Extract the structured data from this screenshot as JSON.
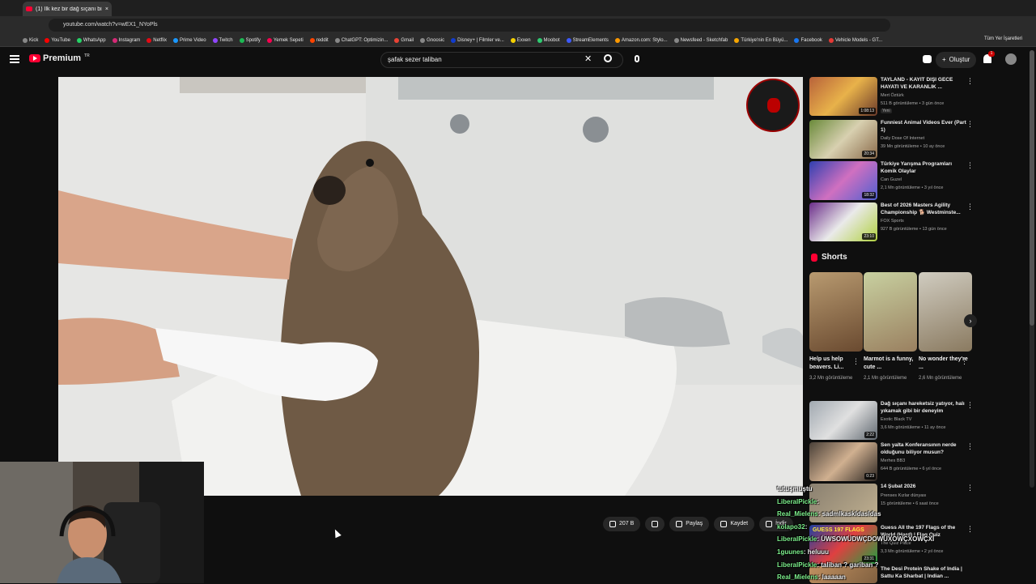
{
  "browser": {
    "tab_title": "(1) İlk kez bir dağ sıçanı bir...",
    "url": "youtube.com/watch?v=wEX1_NYoPls",
    "bookmarks": [
      "Kick",
      "YouTube",
      "WhatsApp",
      "Instagram",
      "Netflix",
      "Prime Video",
      "Twitch",
      "Spotify",
      "Yemek Sepeti",
      "reddit",
      "ChatGPT: Optimizin...",
      "Gmail",
      "Gnoosic",
      "Disney+ | Filmler ve...",
      "Exxen",
      "Moobot",
      "StreamElements",
      "Amazon.com: Stylo...",
      "Newsfeed - Sketchfab",
      "Türkiye'nin En Büyü...",
      "Facebook",
      "Vehicle Models - GT..."
    ],
    "bookmarks_all": "Tüm Yer İşaretleri"
  },
  "header": {
    "logo_text": "Premium",
    "logo_sup": "TR",
    "search_value": "şafak sezer taliban",
    "search_clear": "✕",
    "create_label": "Oluştur",
    "create_plus": "+",
    "notif_count": "1"
  },
  "actions": {
    "like_count": "207 B",
    "share_label": "Paylaş",
    "save_label": "Kaydet",
    "download_label": "İndir"
  },
  "recommendations": [
    {
      "title": "TAYLAND - KAYIT DIŞI GECE HAYATI VE KARANLIK ...",
      "channel": "Mert Öztürk",
      "meta": "511 B görüntüleme • 3 gün önce",
      "badge": "Yeni",
      "duration": "1:08:13"
    },
    {
      "title": "Funniest Animal Videos Ever (Part 1)",
      "channel": "Daily Dose Of Internet",
      "meta": "39 Mn görüntüleme • 10 ay önce",
      "badge": "",
      "duration": "20:34"
    },
    {
      "title": "Türkiye Yarışma Programları Komik Olaylar",
      "channel": "Can Guzel",
      "meta": "2,1 Mn görüntüleme • 3 yıl önce",
      "badge": "",
      "duration": "18:32"
    },
    {
      "title": "Best of 2026 Masters Agility Championship 🐕 Westminste...",
      "channel": "FOX Sports",
      "meta": "927 B görüntüleme • 13 gün önce",
      "badge": "",
      "duration": "23:10"
    }
  ],
  "shorts": {
    "header": "Shorts",
    "next": "›",
    "items": [
      {
        "title": "Help us help beavers. Li...",
        "views": "3,2 Mn görüntüleme"
      },
      {
        "title": "Marmot is a funny, cute ...",
        "views": "2,1 Mn görüntüleme"
      },
      {
        "title": "No wonder they're ...",
        "views": "2,6 Mn görüntüleme"
      }
    ]
  },
  "recommendations2": [
    {
      "title": "Dağ sıçanı hareketsiz yatıyor, halı yıkamak gibi bir deneyim",
      "channel": "Exotic Black TV",
      "meta": "3,6 Mn görüntüleme • 11 ay önce",
      "duration": "2:22"
    },
    {
      "title": "Sen yalta Konferansının nerde olduğunu biliyor musun?",
      "channel": "Merhes BB3",
      "meta": "644 B görüntüleme • 6 yıl önce",
      "duration": "0:23"
    },
    {
      "title": "14 Şubat 2026",
      "channel": "Prenses Kızlar dünyası",
      "meta": "15 görüntüleme • 6 saat önce",
      "duration": ""
    },
    {
      "title": "Guess All the 197 Flags of the World (Hard) | Flag Quiz",
      "channel": "The Quiz Place",
      "meta": "3,3 Mn görüntüleme • 2 yıl önce",
      "duration": "23:31"
    },
    {
      "title": "The Desi Protein Shake of India | Sattu Ka Sharbat | Indian ...",
      "channel": "",
      "meta": "",
      "duration": ""
    }
  ],
  "thumb_text": {
    "flags": "GUESS 197 FLAGS"
  },
  "chat": [
    {
      "user": "tutuşmuştu",
      "msg": "",
      "color": "white"
    },
    {
      "user": "LiberalPickle",
      "msg": ":",
      "color": "green"
    },
    {
      "user": "Real_Mielens",
      "msg": ": sadmlkaskldasldas",
      "color": "green"
    },
    {
      "user": "kolapo32",
      "msg": ":",
      "color": "green"
    },
    {
      "user": "LiberalPickle",
      "msg": ": ÜWSOWÜDWÇDOWÜXOWÇXOWÇXİ",
      "color": "green"
    },
    {
      "user": "1guunes",
      "msg": ": heluuu",
      "color": "green"
    },
    {
      "user": "LiberalPickle",
      "msg": ": taliban ? gariban ?",
      "color": "green"
    },
    {
      "user": "Real_Mielens",
      "msg": ": laaaaan",
      "color": "green"
    }
  ],
  "colors": {
    "accent": "#ff0033",
    "bg": "#0f0f0f",
    "chat_name": "#7df08c"
  }
}
